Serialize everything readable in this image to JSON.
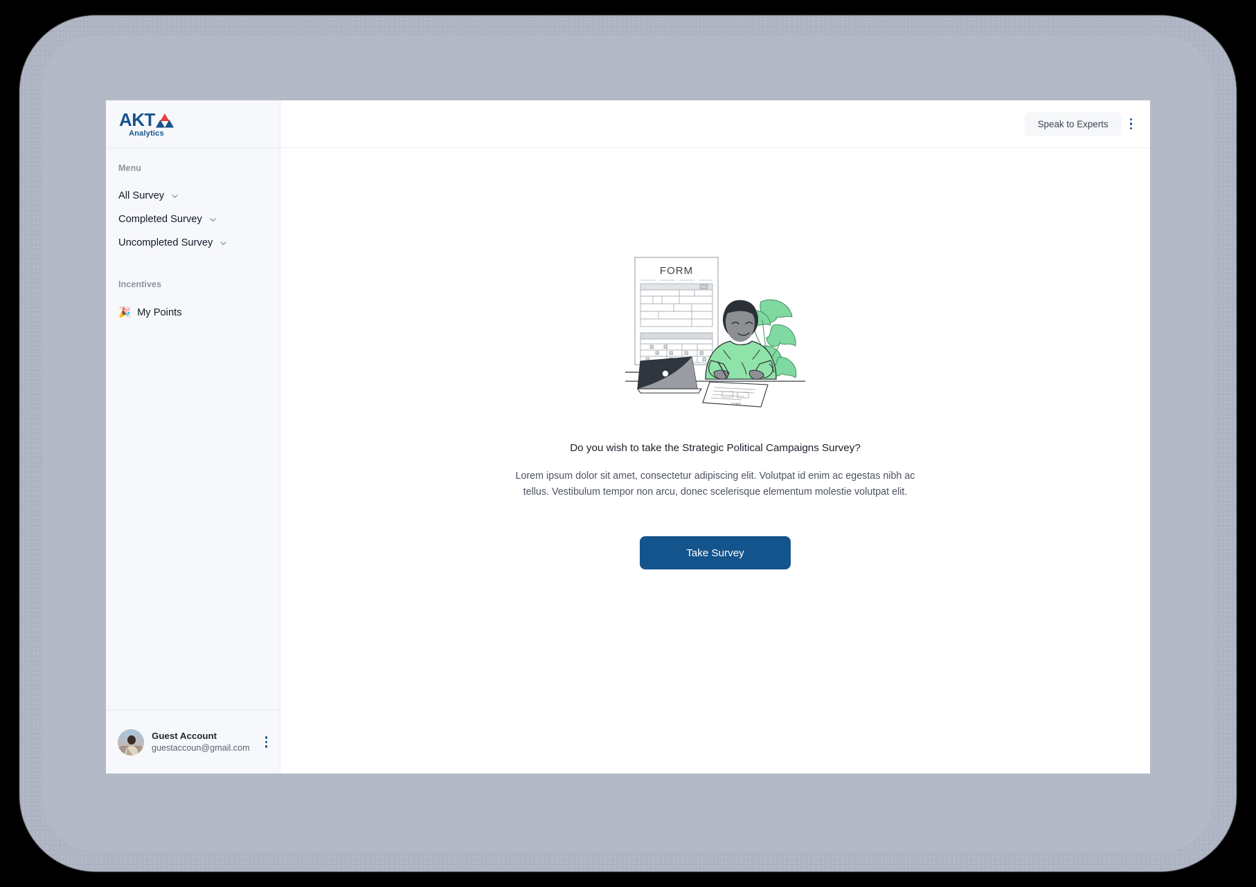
{
  "brand": {
    "name": "AKT",
    "subtitle": "Analytics",
    "logo_blue": "#16538c",
    "logo_red": "#ea3b3b"
  },
  "sidebar": {
    "menu_label": "Menu",
    "menu_items": [
      {
        "label": "All Survey",
        "icon": "chevron-down-icon"
      },
      {
        "label": "Completed Survey",
        "icon": "chevron-down-icon"
      },
      {
        "label": "Uncompleted Survey",
        "icon": "chevron-down-icon"
      }
    ],
    "incentives_label": "Incentives",
    "incentive_items": [
      {
        "label": "My Points",
        "emoji": "🎉"
      }
    ]
  },
  "account": {
    "name": "Guest Account",
    "email": "guestaccoun@gmail.com",
    "menu_icon": "more-vertical-icon"
  },
  "topbar": {
    "experts_label": "Speak to Experts",
    "menu_icon": "more-vertical-icon"
  },
  "main": {
    "illustration": "person-filling-form-illustration",
    "form_title": "FORM",
    "headline": "Do you wish to take the Strategic Political Campaigns Survey?",
    "subtext": "Lorem ipsum dolor sit amet, consectetur adipiscing elit. Volutpat id enim ac egestas nibh ac tellus. Vestibulum tempor non arcu, donec scelerisque elementum molestie volutpat elit.",
    "cta_label": "Take Survey",
    "cta_color": "#14548c"
  }
}
